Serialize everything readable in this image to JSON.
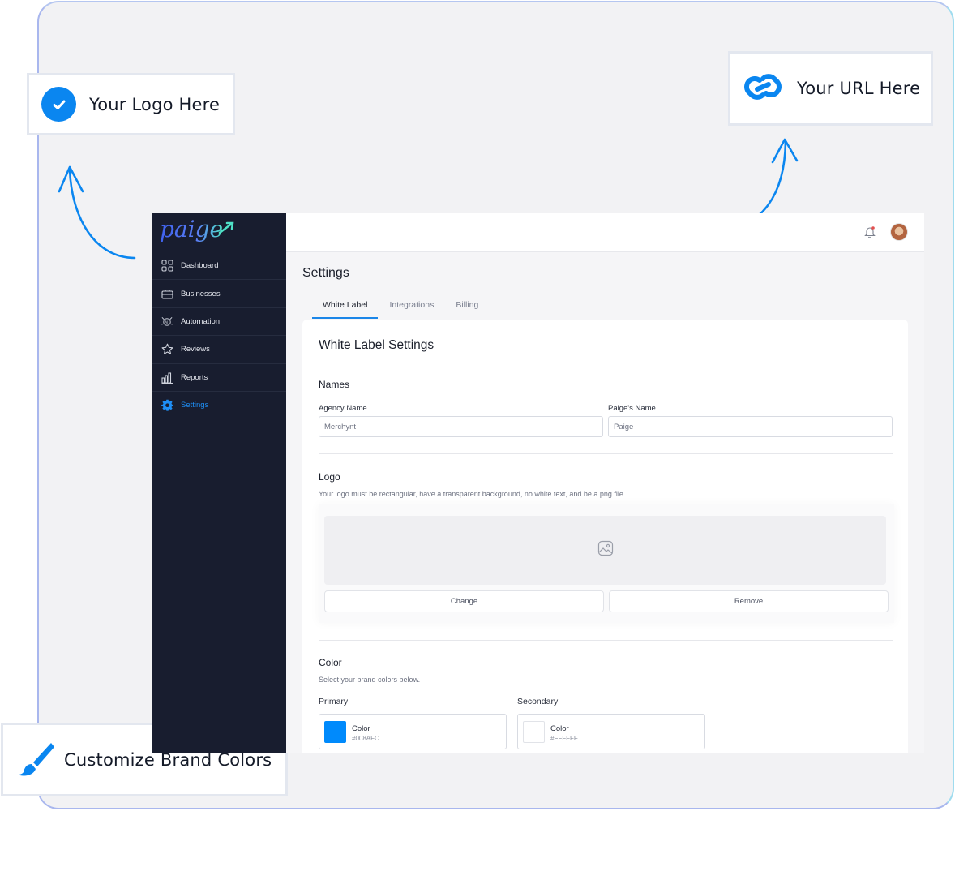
{
  "callouts": {
    "logo": "Your Logo Here",
    "url": "Your URL Here",
    "brand": "Customize Brand Colors"
  },
  "app": {
    "logo_text": "paige",
    "nav": [
      {
        "label": "Dashboard",
        "icon": "grid-icon"
      },
      {
        "label": "Businesses",
        "icon": "briefcase-icon"
      },
      {
        "label": "Automation",
        "icon": "ai-automation-icon"
      },
      {
        "label": "Reviews",
        "icon": "star-icon"
      },
      {
        "label": "Reports",
        "icon": "bar-chart-icon"
      },
      {
        "label": "Settings",
        "icon": "gear-icon",
        "active": true
      }
    ],
    "page_title": "Settings",
    "tabs": [
      "White Label",
      "Integrations",
      "Billing"
    ],
    "active_tab": "White Label",
    "card_title": "White Label Settings",
    "names": {
      "heading": "Names",
      "agency_label": "Agency Name",
      "agency_value": "Merchynt",
      "paige_label": "Paige's Name",
      "paige_value": "Paige"
    },
    "logo": {
      "heading": "Logo",
      "hint": "Your logo must be rectangular, have a transparent background, no white text, and be a png file.",
      "change": "Change",
      "remove": "Remove"
    },
    "color": {
      "heading": "Color",
      "hint": "Select your brand colors below.",
      "primary_label": "Primary",
      "secondary_label": "Secondary",
      "primary_title": "Color",
      "primary_hex": "#008AFC",
      "secondary_title": "Color",
      "secondary_hex": "#FFFFFF"
    }
  },
  "colors": {
    "accent": "#0a86f0",
    "sidebar_bg": "#181d2f",
    "primary_swatch": "#008AFC",
    "secondary_swatch": "#FFFFFF"
  }
}
